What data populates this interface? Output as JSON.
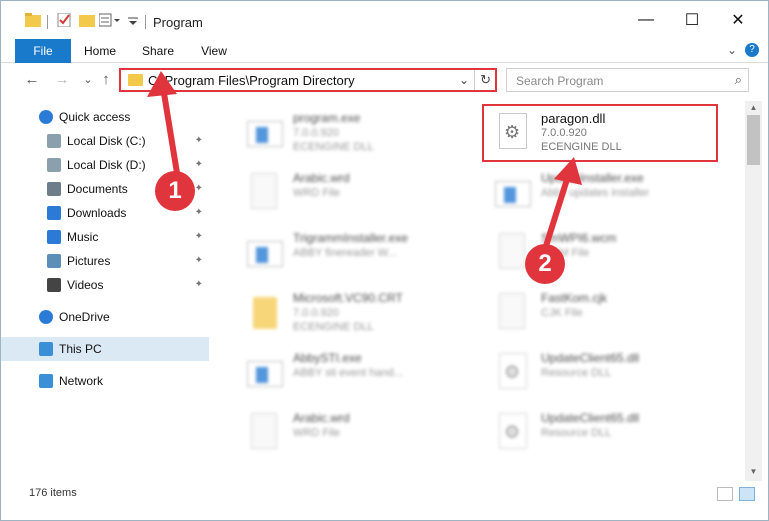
{
  "window": {
    "title": "Program"
  },
  "ribbon": {
    "tabs": [
      "File",
      "Home",
      "Share",
      "View"
    ],
    "chevron": "⌄",
    "help": "?"
  },
  "toolbar": {
    "back": "←",
    "forward": "→",
    "recent": "⌄",
    "up": "↑"
  },
  "address": {
    "path": "C:\\Program Files\\Program Directory",
    "dropdown": "⌄",
    "refresh": "↻"
  },
  "search": {
    "placeholder": "Search Program",
    "icon": "⌕"
  },
  "nav": {
    "items": [
      {
        "label": "Quick access",
        "icon": "star-icon",
        "pinned": false
      },
      {
        "label": "Local Disk (C:)",
        "icon": "drive-icon",
        "pinned": true
      },
      {
        "label": "Local Disk (D:)",
        "icon": "drive-icon",
        "pinned": true
      },
      {
        "label": "Documents",
        "icon": "documents-icon",
        "pinned": true
      },
      {
        "label": "Downloads",
        "icon": "download-icon",
        "pinned": true
      },
      {
        "label": "Music",
        "icon": "music-icon",
        "pinned": true
      },
      {
        "label": "Pictures",
        "icon": "pictures-icon",
        "pinned": true
      },
      {
        "label": "Videos",
        "icon": "videos-icon",
        "pinned": true
      },
      {
        "label": "OneDrive",
        "icon": "cloud-icon",
        "pinned": false
      },
      {
        "label": "This PC",
        "icon": "computer-icon",
        "pinned": false,
        "selected": true
      },
      {
        "label": "Network",
        "icon": "network-icon",
        "pinned": false
      }
    ],
    "pin_glyph": "📌"
  },
  "files": [
    {
      "name": "program.exe",
      "sub1": "7.0.0.920",
      "sub2": "ECENGINE DLL",
      "icon": "installer-icon",
      "col": 0,
      "row": 0
    },
    {
      "name": "paragon.dll",
      "sub1": "7.0.0.920",
      "sub2": "ECENGINE DLL",
      "icon": "dll-icon",
      "col": 1,
      "row": 0,
      "highlighted": true
    },
    {
      "name": "Arabic.wrd",
      "sub1": "WRD File",
      "sub2": "",
      "icon": "file-icon",
      "col": 0,
      "row": 1
    },
    {
      "name": "UpdateInstaller.exe",
      "sub1": "Abby updates installer",
      "sub2": "",
      "icon": "app-icon",
      "col": 1,
      "row": 1
    },
    {
      "name": "TrigrammInstaller.exe",
      "sub1": "ABBY finereader W...",
      "sub2": "",
      "icon": "app-icon",
      "col": 0,
      "row": 2
    },
    {
      "name": "SmWPI6.wcm",
      "sub1": "WCM File",
      "sub2": "",
      "icon": "file-icon",
      "col": 1,
      "row": 2
    },
    {
      "name": "Microsoft.VC90.CRT",
      "sub1": "7.0.0.920",
      "sub2": "ECENGINE DLL",
      "icon": "folder-icon",
      "col": 0,
      "row": 3
    },
    {
      "name": "FastKom.cjk",
      "sub1": "CJK File",
      "sub2": "",
      "icon": "file-icon",
      "col": 1,
      "row": 3
    },
    {
      "name": "AbbySTI.exe",
      "sub1": "ABBY sti event hand...",
      "sub2": "",
      "icon": "app-icon",
      "col": 0,
      "row": 4
    },
    {
      "name": "UpdateClient65.dll",
      "sub1": "Resource DLL",
      "sub2": "",
      "icon": "dll-icon",
      "col": 1,
      "row": 4
    },
    {
      "name": "Arabic.wrd",
      "sub1": "WRD File",
      "sub2": "",
      "icon": "file-icon",
      "col": 0,
      "row": 5
    },
    {
      "name": "UpdateClient65.dll",
      "sub1": "Resource DLL",
      "sub2": "",
      "icon": "dll-icon",
      "col": 1,
      "row": 5
    }
  ],
  "status": {
    "count": "176 items"
  },
  "annotations": [
    {
      "label": "1"
    },
    {
      "label": "2"
    }
  ],
  "colors": {
    "accent": "#1979ca",
    "annotation": "#e0353c",
    "folder": "#f3c94c"
  }
}
